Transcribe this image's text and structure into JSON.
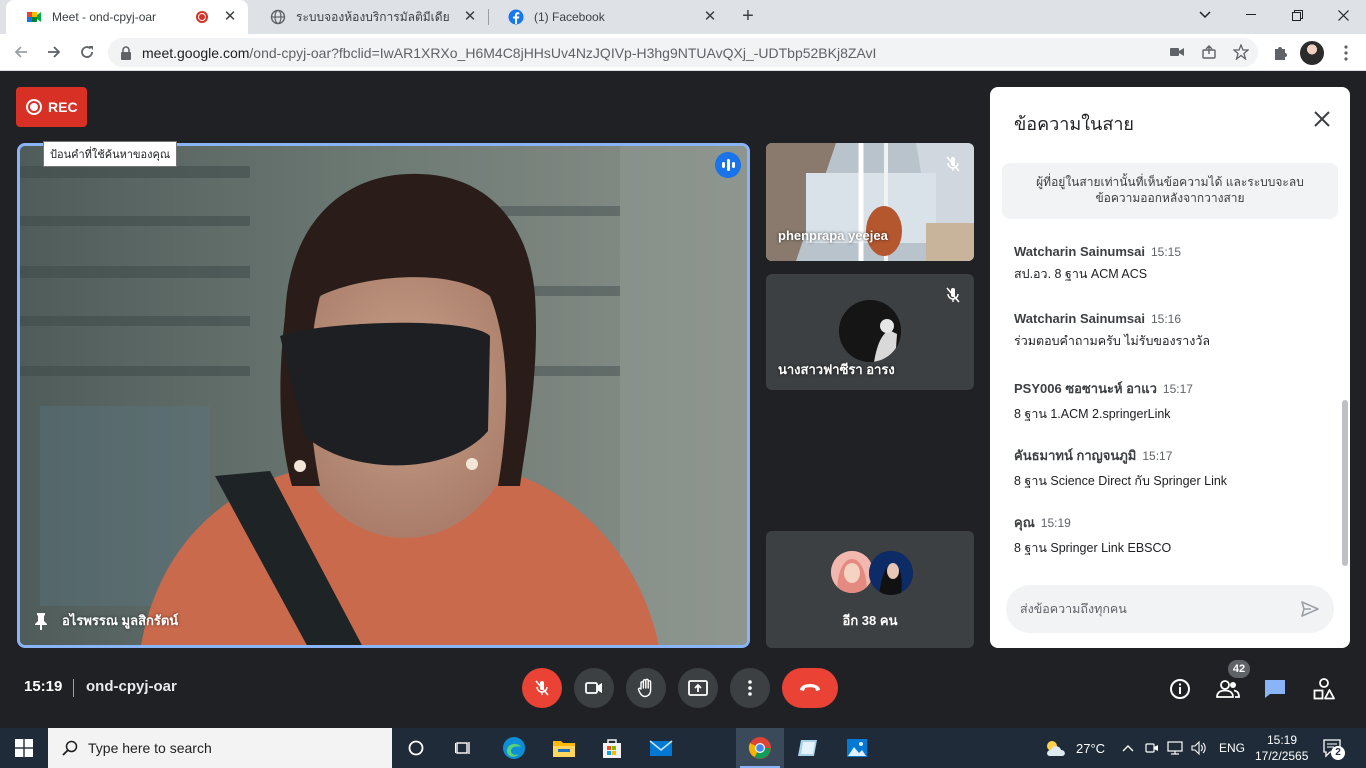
{
  "browser": {
    "tabs": [
      {
        "title": "Meet - ond-cpyj-oar",
        "icon": "google-meet-icon",
        "recording": true
      },
      {
        "title": "ระบบจองห้องบริการมัลติมีเดีย",
        "icon": "globe-icon"
      },
      {
        "title": "(1) Facebook",
        "icon": "facebook-icon"
      }
    ],
    "new_tab": "+",
    "url_host": "meet.google.com",
    "url_path": "/ond-cpyj-oar?fbclid=IwAR1XRXo_H6M4C8jHHsUv4NzJQIVp-H3hg9NTUAvQXj_-UDTbp52BKj8ZAvI"
  },
  "meet": {
    "rec_label": "REC",
    "tooltip": "ป้อนคำที่ใช้ค้นหาของคุณ",
    "main_participant": "อไรพรรณ มูลสิกรัตน์",
    "participants": [
      {
        "name": "phenprapa yeejea"
      },
      {
        "name": "นางสาวฟาซีรา อารง"
      }
    ],
    "others_label": "อีก 38 คน",
    "time": "15:19",
    "meeting_code": "ond-cpyj-oar",
    "people_count": "42"
  },
  "chat": {
    "title": "ข้อความในสาย",
    "notice": "ผู้ที่อยู่ในสายเท่านั้นที่เห็นข้อความได้ และระบบจะลบข้อความออกหลังจากวางสาย",
    "messages": [
      {
        "sender": "Watcharin Sainumsai",
        "time": "15:15",
        "text": "สป.อว. 8 ฐาน  ACM ACS"
      },
      {
        "sender": "Watcharin Sainumsai",
        "time": "15:16",
        "text": "ร่วมตอบคำถามครับ ไม่รับของรางวัล"
      },
      {
        "sender": "PSY006 ซอซานะห์ อาแว",
        "time": "15:17",
        "text": "8 ฐาน 1.ACM 2.springerLink"
      },
      {
        "sender": "คันธมาทน์ กาญจนภูมิ",
        "time": "15:17",
        "text": "8 ฐาน Science Direct กับ Springer Link"
      },
      {
        "sender": "คุณ",
        "time": "15:19",
        "text": "8 ฐาน Springer Link   EBSCO"
      }
    ],
    "input_placeholder": "ส่งข้อความถึงทุกคน"
  },
  "taskbar": {
    "search_placeholder": "Type here to search",
    "temperature": "27°C",
    "language": "ENG",
    "clock_time": "15:19",
    "clock_date": "17/2/2565",
    "notification_count": "2"
  },
  "colors": {
    "accent_blue": "#1a73e8",
    "danger_red": "#ea4335",
    "rec_red": "#d93025",
    "meet_bg": "#202124"
  }
}
